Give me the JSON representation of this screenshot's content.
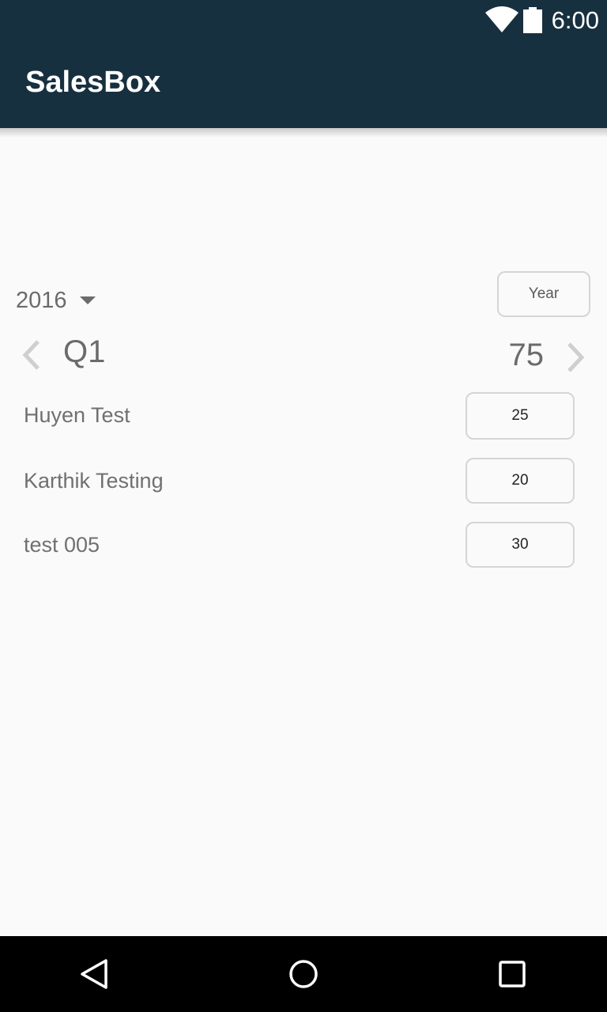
{
  "status_bar": {
    "time": "6:00",
    "icons": [
      "wifi-icon",
      "battery-icon"
    ]
  },
  "app_bar": {
    "title": "SalesBox",
    "color": "#173040"
  },
  "filters": {
    "year_selected": "2016",
    "period_button_label": "Year"
  },
  "period": {
    "quarter": "Q1",
    "total": "75"
  },
  "people": [
    {
      "name": "Huyen Test",
      "target": "25"
    },
    {
      "name": "Karthik Testing",
      "target": "20"
    },
    {
      "name": "test 005",
      "target": "30"
    }
  ],
  "nav_bar": {
    "icons": [
      "back-icon",
      "home-icon",
      "recent-apps-icon"
    ]
  }
}
